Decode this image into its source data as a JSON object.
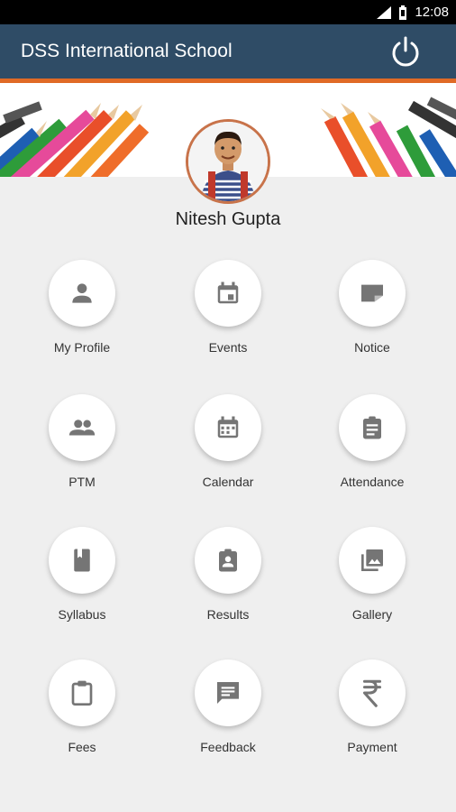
{
  "status_bar": {
    "time": "12:08"
  },
  "app_bar": {
    "title": "DSS International School",
    "power_icon": "power-icon"
  },
  "profile": {
    "name": "Nitesh Gupta"
  },
  "menu": [
    {
      "label": "My Profile",
      "icon": "person-icon"
    },
    {
      "label": "Events",
      "icon": "event-calendar-icon"
    },
    {
      "label": "Notice",
      "icon": "note-icon"
    },
    {
      "label": "PTM",
      "icon": "group-icon"
    },
    {
      "label": "Calendar",
      "icon": "calendar-icon"
    },
    {
      "label": "Attendance",
      "icon": "clipboard-list-icon"
    },
    {
      "label": "Syllabus",
      "icon": "book-icon"
    },
    {
      "label": "Results",
      "icon": "id-card-icon"
    },
    {
      "label": "Gallery",
      "icon": "photo-library-icon"
    },
    {
      "label": "Fees",
      "icon": "clipboard-icon"
    },
    {
      "label": "Feedback",
      "icon": "feedback-icon"
    },
    {
      "label": "Payment",
      "icon": "rupee-icon"
    }
  ],
  "colors": {
    "app_bar": "#2f4c66",
    "accent_line": "#e06a26",
    "icon_gray": "#757575",
    "background": "#efefef"
  }
}
